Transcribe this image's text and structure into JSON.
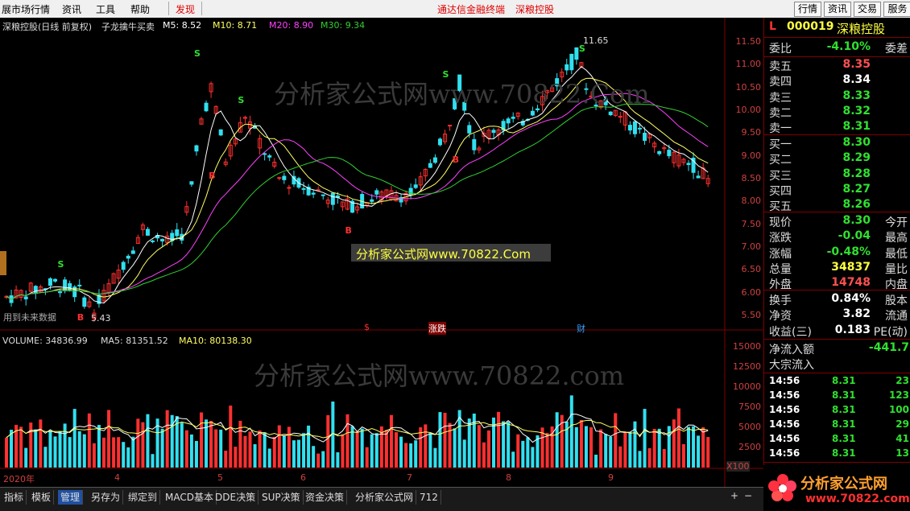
{
  "menubar": {
    "items": [
      "展市场行情",
      "资讯",
      "工具",
      "帮助"
    ],
    "find_label": "发现",
    "promo1": "通达信金融终端",
    "promo2": "深粮控股",
    "right_buttons": [
      "行情",
      "资讯",
      "交易",
      "服务"
    ]
  },
  "chart_header": {
    "name": "深粮控股(日线 前复权)",
    "formula": "子龙擒牛买卖",
    "ma5": "M5: 8.52",
    "ma10": "M10: 8.71",
    "ma20": "M20: 8.90",
    "ma30": "M30: 9.34"
  },
  "volume_header": {
    "volume": "VOLUME: 34836.99",
    "ma5": "MA5: 81351.52",
    "ma10": "MA10: 80138.30"
  },
  "annotations": {
    "high": "11.65",
    "low": "5.43",
    "future_data": "用到未来数据",
    "watermark_box": "分析家公式网www.70822.Com",
    "watermark1": "分析家公式网www.70822.Com",
    "watermark2": "分析家公式网www.70822.com",
    "event_s": "$",
    "event_rise": "涨跌",
    "event_fin": "财",
    "multiplier": "X100"
  },
  "signals": {
    "sell": "S",
    "buy": "B"
  },
  "price_axis": [
    "11.50",
    "11.00",
    "10.50",
    "10.00",
    "9.50",
    "9.00",
    "8.50",
    "8.00",
    "7.50",
    "7.00",
    "6.50",
    "6.00",
    "5.50"
  ],
  "volume_axis": [
    "15000",
    "12500",
    "10000",
    "7500",
    "5000",
    "2500"
  ],
  "x_axis": [
    "2020年",
    "4",
    "5",
    "6",
    "7",
    "8",
    "9"
  ],
  "quote": {
    "flag": "L",
    "code": "000019",
    "name": "深粮控股",
    "weibi_label": "委比",
    "weibi_value": "-4.10%",
    "weicha_label": "委差",
    "asks": [
      {
        "label": "卖五",
        "price": "8.35",
        "color": "#ff5050"
      },
      {
        "label": "卖四",
        "price": "8.34",
        "color": "#ffffff"
      },
      {
        "label": "卖三",
        "price": "8.33",
        "color": "#30e030"
      },
      {
        "label": "卖二",
        "price": "8.32",
        "color": "#30e030"
      },
      {
        "label": "卖一",
        "price": "8.31",
        "color": "#30e030"
      }
    ],
    "bids": [
      {
        "label": "买一",
        "price": "8.30",
        "color": "#30e030"
      },
      {
        "label": "买二",
        "price": "8.29",
        "color": "#30e030"
      },
      {
        "label": "买三",
        "price": "8.28",
        "color": "#30e030"
      },
      {
        "label": "买四",
        "price": "8.27",
        "color": "#30e030"
      },
      {
        "label": "买五",
        "price": "8.26",
        "color": "#30e030"
      }
    ],
    "stats": [
      {
        "label": "现价",
        "value": "8.30",
        "right": "今开",
        "color": "#30e030"
      },
      {
        "label": "涨跌",
        "value": "-0.04",
        "right": "最高",
        "color": "#30e030"
      },
      {
        "label": "涨幅",
        "value": "-0.48%",
        "right": "最低",
        "color": "#30e030"
      },
      {
        "label": "总量",
        "value": "34837",
        "right": "量比",
        "color": "#ffff40"
      },
      {
        "label": "外盘",
        "value": "14748",
        "right": "内盘",
        "color": "#ff5050"
      }
    ],
    "stats2": [
      {
        "label": "换手",
        "value": "0.84%",
        "right": "股本",
        "color": "#ffffff"
      },
      {
        "label": "净资",
        "value": "3.82",
        "right": "流通",
        "color": "#ffffff"
      },
      {
        "label": "收益(三)",
        "value": "0.183",
        "right": "PE(动)",
        "color": "#ffffff"
      }
    ],
    "net_inflow_label": "净流入额",
    "net_inflow_value": "-441.7",
    "block_inflow_label": "大宗流入",
    "ticks": [
      {
        "time": "14:56",
        "price": "8.31",
        "vol": "23"
      },
      {
        "time": "14:56",
        "price": "8.31",
        "vol": "123"
      },
      {
        "time": "14:56",
        "price": "8.31",
        "vol": "100"
      },
      {
        "time": "14:56",
        "price": "8.31",
        "vol": "29"
      },
      {
        "time": "14:56",
        "price": "8.31",
        "vol": "41"
      },
      {
        "time": "14:56",
        "price": "8.31",
        "vol": "13"
      }
    ],
    "period_label": "日线"
  },
  "bottom_tabs": [
    "指标",
    "模板",
    "管理",
    "另存为",
    "绑定到",
    "MACD基本",
    "DDE决策",
    "SUP决策",
    "资金决策",
    "分析家公式网",
    "712"
  ],
  "logo": {
    "text": "分析家公式网",
    "url": "www.70822.com"
  },
  "colors": {
    "up": "#ff3030",
    "down": "#30e0f0",
    "ma5": "#ffffff",
    "ma10": "#ffff60",
    "ma20": "#ff40ff",
    "ma30": "#30d030"
  }
}
